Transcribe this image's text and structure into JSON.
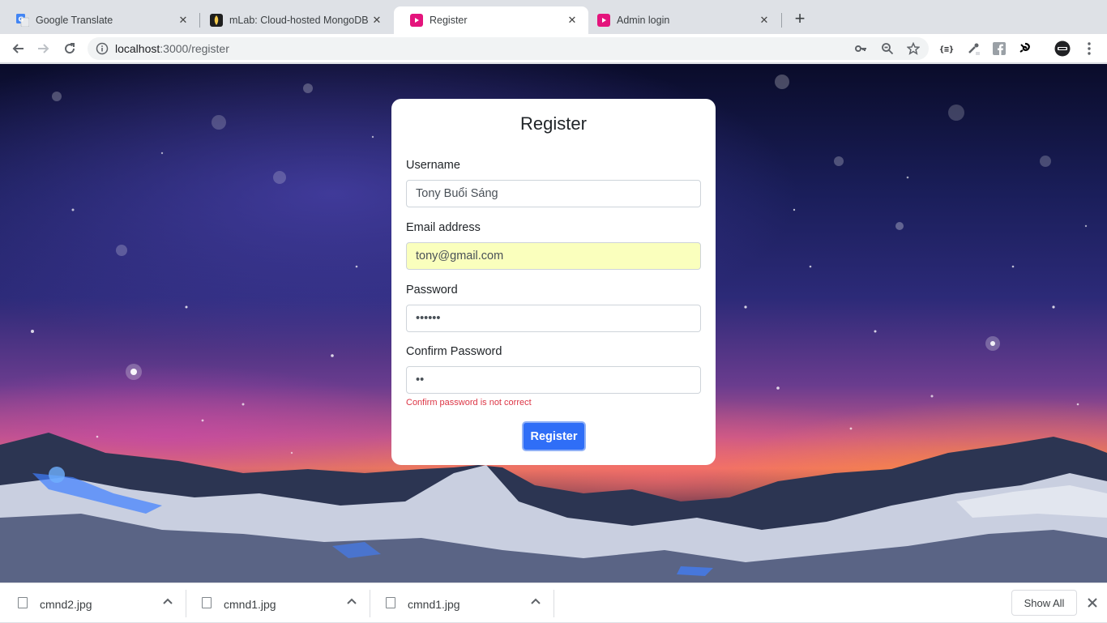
{
  "browser": {
    "tabs": [
      {
        "title": "Google Translate",
        "icon": "google-translate-icon",
        "active": false
      },
      {
        "title": "mLab: Cloud-hosted MongoDB",
        "icon": "mlab-icon",
        "active": false
      },
      {
        "title": "Register",
        "icon": "youtube-like-icon",
        "active": true
      },
      {
        "title": "Admin login",
        "icon": "youtube-like-icon",
        "active": false
      }
    ],
    "close_symbol": "✕",
    "new_tab_symbol": "+",
    "url_host": "localhost",
    "url_path": ":3000/register"
  },
  "form": {
    "title": "Register",
    "username_label": "Username",
    "username_value": "Tony Buổi Sáng",
    "email_label": "Email address",
    "email_value": "tony@gmail.com",
    "password_label": "Password",
    "password_value": "••••••",
    "confirm_label": "Confirm Password",
    "confirm_value": "••",
    "error_text": "Confirm password is not correct",
    "submit_label": "Register"
  },
  "downloads": {
    "items": [
      {
        "name": "cmnd2.jpg"
      },
      {
        "name": "cmnd1.jpg"
      },
      {
        "name": "cmnd1.jpg"
      }
    ],
    "show_all_label": "Show All"
  },
  "colors": {
    "primary_button": "#2f6ef7",
    "error": "#dc3545",
    "autofill": "#faffbd",
    "tab_favicon_pink": "#e4147c"
  }
}
